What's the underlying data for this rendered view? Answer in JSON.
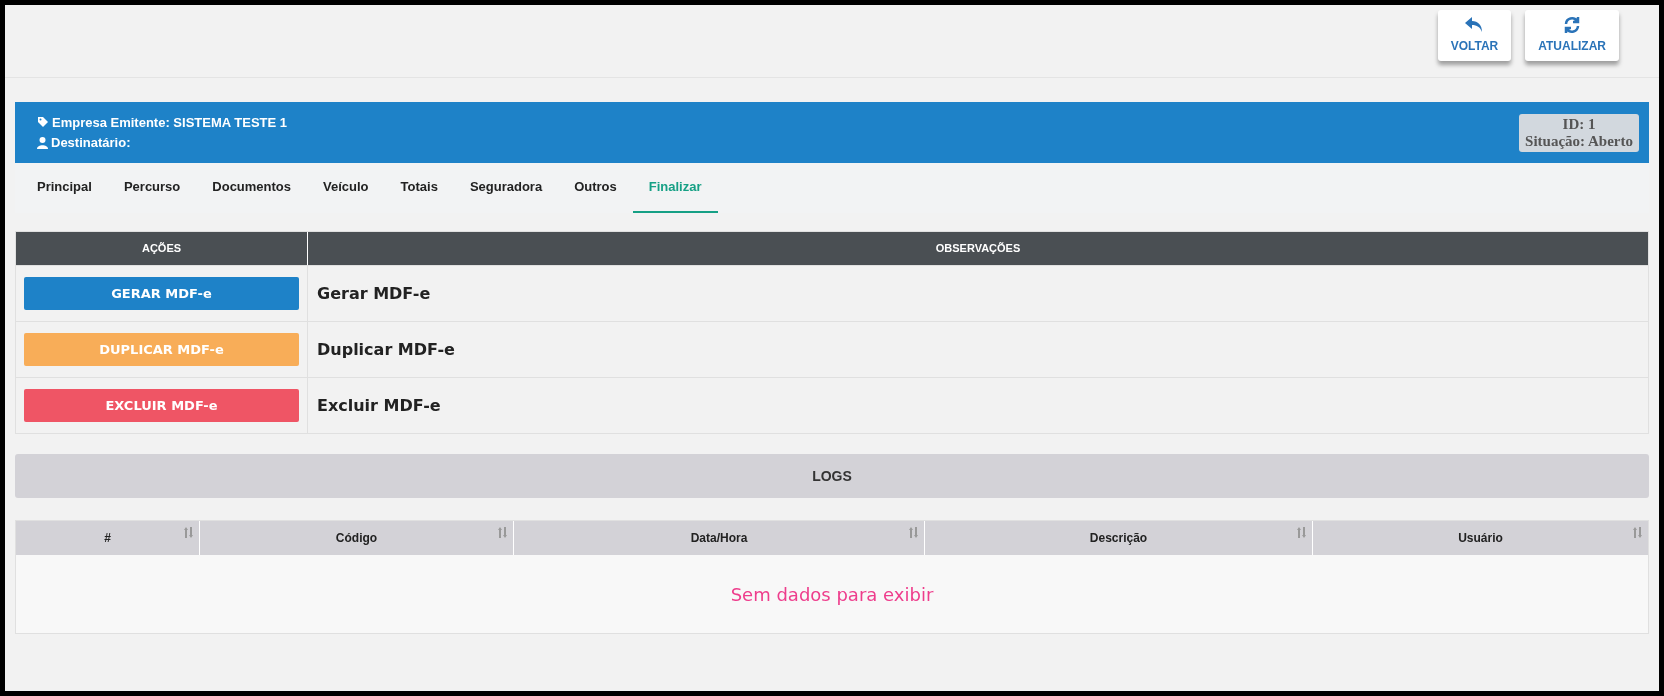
{
  "toolbar": [
    {
      "kind": "back",
      "label": "VOLTAR"
    },
    {
      "kind": "refresh",
      "label": "ATUALIZAR"
    }
  ],
  "header": {
    "emitter": "Empresa Emitente: SISTEMA TESTE 1",
    "recipient": "Destinatário:",
    "id": "ID: 1",
    "status": "Situação: Aberto"
  },
  "tabs": [
    {
      "label": "Principal",
      "selected": false
    },
    {
      "label": "Percurso",
      "selected": false
    },
    {
      "label": "Documentos",
      "selected": false
    },
    {
      "label": "Veículo",
      "selected": false
    },
    {
      "label": "Totais",
      "selected": false
    },
    {
      "label": "Seguradora",
      "selected": false
    },
    {
      "label": "Outros",
      "selected": false
    },
    {
      "label": "Finalizar",
      "selected": true
    }
  ],
  "actions_table": {
    "columns": [
      "AÇÕES",
      "OBSERVAÇÕES"
    ],
    "rows": [
      {
        "kind": "primary",
        "button": "GERAR MDF-e",
        "note": "Gerar MDF-e"
      },
      {
        "kind": "warning",
        "button": "DUPLICAR MDF-e",
        "note": "Duplicar MDF-e"
      },
      {
        "kind": "danger",
        "button": "EXCLUIR MDF-e",
        "note": "Excluir MDF-e"
      }
    ]
  },
  "logs": {
    "title": "LOGS",
    "columns": [
      "#",
      "Código",
      "Data/Hora",
      "Descrição",
      "Usuário"
    ],
    "empty_message": "Sem dados para exibir"
  }
}
